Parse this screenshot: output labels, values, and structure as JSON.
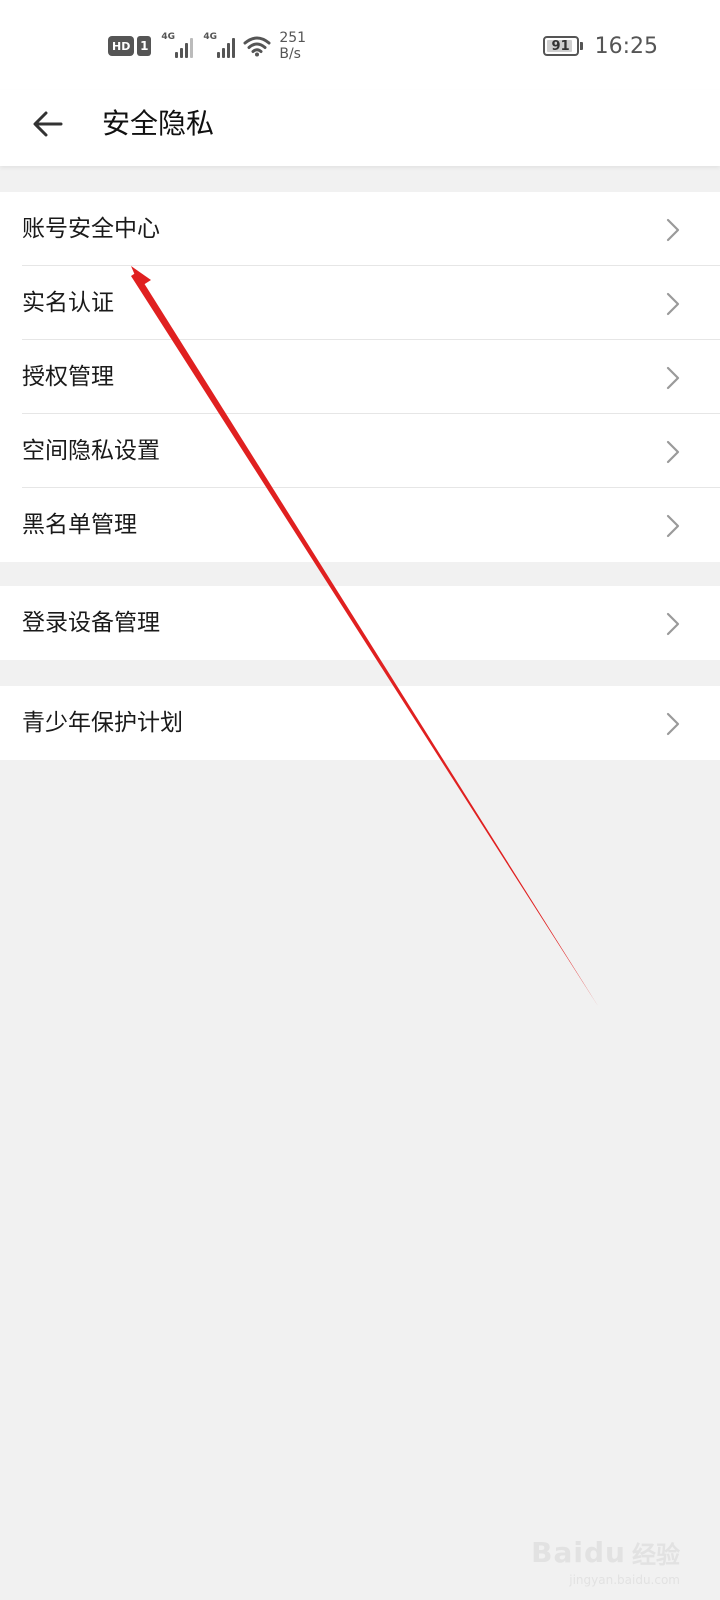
{
  "status_bar": {
    "hd": "HD",
    "sim": "1",
    "signal1_tag": "4G",
    "signal2_tag": "4G",
    "speed_value": "251",
    "speed_unit": "B/s",
    "battery_level": "91",
    "battery_fraction": 0.91,
    "time": "16:25",
    "icons": [
      "hd-icon",
      "sim-icon",
      "signal-icon",
      "signal-icon",
      "wifi-icon",
      "battery-icon"
    ]
  },
  "header": {
    "title": "安全隐私",
    "back_icon": "arrow-left-icon"
  },
  "groups": [
    {
      "items": [
        {
          "label": "账号安全中心",
          "icon": "chevron-right-icon"
        },
        {
          "label": "实名认证",
          "icon": "chevron-right-icon"
        },
        {
          "label": "授权管理",
          "icon": "chevron-right-icon"
        },
        {
          "label": "空间隐私设置",
          "icon": "chevron-right-icon"
        },
        {
          "label": "黑名单管理",
          "icon": "chevron-right-icon"
        }
      ]
    },
    {
      "items": [
        {
          "label": "登录设备管理",
          "icon": "chevron-right-icon"
        }
      ]
    },
    {
      "items": [
        {
          "label": "青少年保护计划",
          "icon": "chevron-right-icon"
        }
      ]
    }
  ],
  "annotation": {
    "type": "arrow",
    "color": "#e02020",
    "points_to": "账号安全中心"
  },
  "watermark": {
    "main": "Bai",
    "paw": "du",
    "cn": "经验",
    "url": "jingyan.baidu.com"
  },
  "colors": {
    "page_bg": "#f1f1f1",
    "card_bg": "#ffffff",
    "text": "#1a1a1a",
    "chevron": "#9a9a9a",
    "divider": "#e6e6e6"
  }
}
